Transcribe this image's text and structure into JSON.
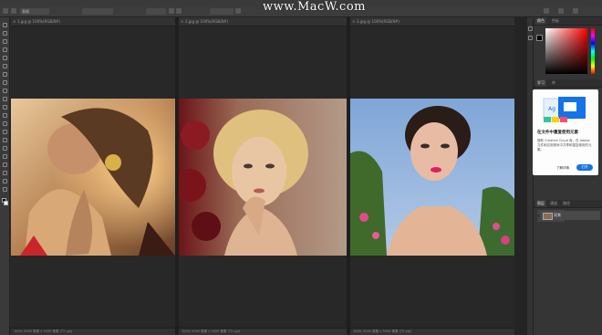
{
  "watermark": "www.MacW.com",
  "options_bar": {
    "preset": "表格",
    "items": [
      "",
      "",
      "",
      "",
      "",
      "",
      "",
      ""
    ]
  },
  "documents": [
    {
      "tab": "1.jpg @ 100%(RGB/8#)",
      "status": "100%    5000 像素 x 3000 像素 (72 ppi)"
    },
    {
      "tab": "2.jpg @ 100%(RGB/8#)",
      "status": "100%    5000 像素 x 3000 像素 (72 ppi)"
    },
    {
      "tab": "3.jpg @ 100%(RGB/8#)",
      "status": "100%    5000 像素 x 3000 像素 (72 ppi)"
    }
  ],
  "panels": {
    "top_tabs": [
      "颜色",
      "色板"
    ],
    "learn_tabs": [
      "学习",
      "库"
    ],
    "layers_tabs": [
      "图层",
      "通道",
      "路径"
    ],
    "layer_name": "背景"
  },
  "card": {
    "title": "在文件中重复使用元素",
    "body": "借助 Creative Cloud 库，在 Adobe 文件和应用程序中共享和重复使用的元素。",
    "link": "了解详情",
    "button": "打开"
  },
  "colors": {
    "accent": "#1473e6",
    "canvas": "#282828"
  }
}
